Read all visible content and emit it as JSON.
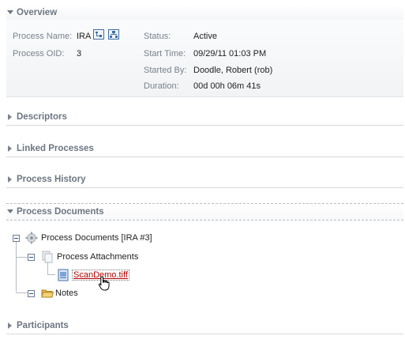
{
  "sections": {
    "overview": "Overview",
    "descriptors": "Descriptors",
    "linked": "Linked Processes",
    "history": "Process History",
    "documents": "Process Documents",
    "participants": "Participants"
  },
  "overview": {
    "process_name_label": "Process Name:",
    "process_name": "IRA",
    "process_oid_label": "Process OID:",
    "process_oid": "3",
    "status_label": "Status:",
    "status": "Active",
    "start_time_label": "Start Time:",
    "start_time": "09/29/11 01:03 PM",
    "started_by_label": "Started By:",
    "started_by": "Doodle, Robert (rob)",
    "duration_label": "Duration:",
    "duration": "00d 00h 06m 41s"
  },
  "tree": {
    "root": "Process Documents [IRA #3]",
    "attachments": "Process Attachments",
    "file": "ScanDemo.tiff",
    "notes": "Notes"
  },
  "icons": {
    "root": "gear-icon",
    "attachments": "pages-icon",
    "file": "image-file-icon",
    "notes": "folder-icon",
    "cursor": "hand-cursor-icon"
  },
  "colors": {
    "header_text": "#6d7682",
    "link": "#b40000",
    "icon_border": "#3f6ea8"
  }
}
